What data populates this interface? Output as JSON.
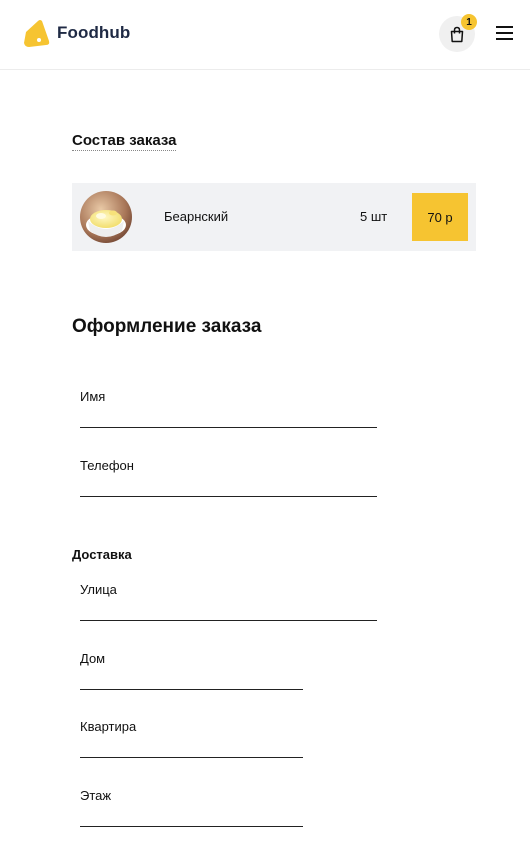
{
  "header": {
    "brand": "Foodhub",
    "logo_icon": "foodhub-logo-icon",
    "cart_icon": "shopping-bag-icon",
    "cart_count": "1",
    "menu_icon": "hamburger-menu-icon",
    "accent_color": "#f6c431"
  },
  "order": {
    "title": "Состав заказа",
    "items": [
      {
        "name": "Беарнский",
        "qty": "5 шт",
        "price": "70 р",
        "image_icon": "bearnaise-sauce-image"
      }
    ]
  },
  "checkout": {
    "title": "Оформление заказа",
    "fields": {
      "name": {
        "label": "Имя",
        "value": ""
      },
      "phone": {
        "label": "Телефон",
        "value": ""
      }
    },
    "delivery": {
      "title": "Доставка",
      "street": {
        "label": "Улица",
        "value": ""
      },
      "house": {
        "label": "Дом",
        "value": ""
      },
      "apartment": {
        "label": "Квартира",
        "value": ""
      },
      "floor": {
        "label": "Этаж",
        "value": ""
      }
    }
  }
}
